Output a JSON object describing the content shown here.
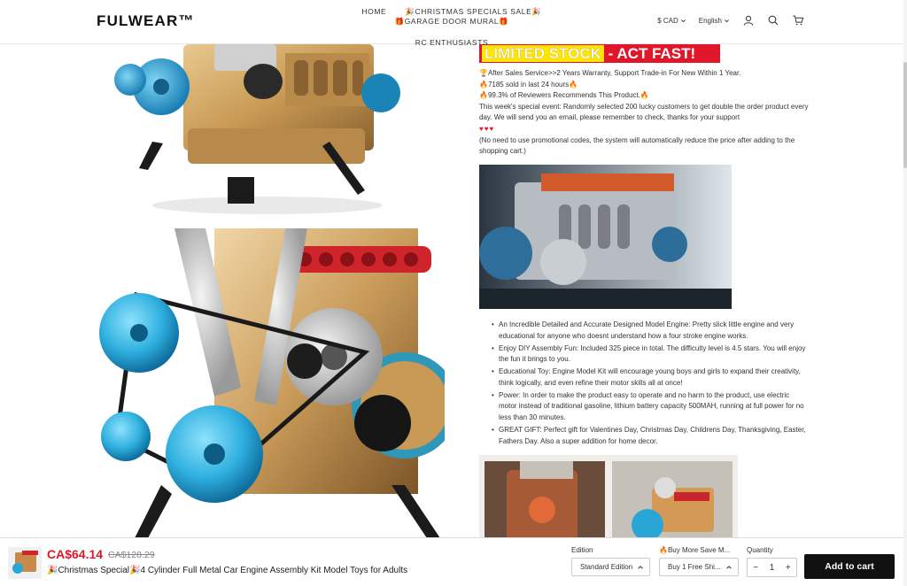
{
  "header": {
    "logo": "FULWEAR™",
    "nav": [
      {
        "label": "HOME"
      },
      {
        "label": "🎉CHRISTMAS SPECIALS SALE🎉"
      },
      {
        "label": "🎁GARAGE DOOR MURAL🎁"
      },
      {
        "label": "RC ENTHUSIASTS"
      }
    ],
    "currency": "$ CAD",
    "language": "English",
    "icons": [
      "user-icon",
      "search-icon",
      "cart-icon"
    ]
  },
  "product": {
    "banner_highlight": "LIMITED STOCK",
    "banner_rest": " - ACT FAST!",
    "info_lines": [
      "🏆After Sales Service>>2 Years Warranty, Support Trade-in For New Within 1 Year.",
      "🔥7185 sold in last 24 hours🔥",
      "🔥99.3% of Reviewers Recommends This Product.🔥",
      "This week's special event: Randomly selected 200 lucky customers to get double the order product every day. We will send you an email, please remember to check, thanks for your support"
    ],
    "hearts": "♥♥♥",
    "promo_note": "(No need to use promotional codes, the system will automatically reduce the price after adding to the shopping cart.)",
    "bullets": [
      "An Incredible Detailed and Accurate Designed Model Engine: Pretty slick little engine and very educational for anyone who doesnt understand how a four stroke engine works.",
      "Enjoy DIY Assembly Fun: Included 325 piece in total. The difficulty level is 4.5 stars. You will enjoy the fun it brings to you.",
      "Educational Toy: Engine Model Kit will encourage young boys and girls to expand their creativity, think logically, and even refine their motor skills all at once!",
      "Power: In order to make the product easy to operate and no harm to the product, use electric motor instead of traditional gasoline, lithium battery capacity 500MAH, running at full power for no less than 30 minutes.",
      "GREAT GIFT: Perfect gift for Valentines Day, Christmas Day, Childrens Day, Thanksgiving, Easter, Fathers Day. Also a super addition for home decor."
    ]
  },
  "sticky": {
    "price": "CA$64.14",
    "old_price": "CA$128.29",
    "title": "🎉Christmas Special🎉4 Cylinder Full Metal Car Engine Assembly Kit Model Toys for Adults",
    "edition_label": "Edition",
    "edition_value": "Standard Edition",
    "buymore_label": "🔥Buy More Save M...",
    "buymore_value": "Buy 1 Free Shi...",
    "quantity_label": "Quantity",
    "quantity_value": "1",
    "minus": "−",
    "plus": "+",
    "add_to_cart": "Add to cart"
  }
}
